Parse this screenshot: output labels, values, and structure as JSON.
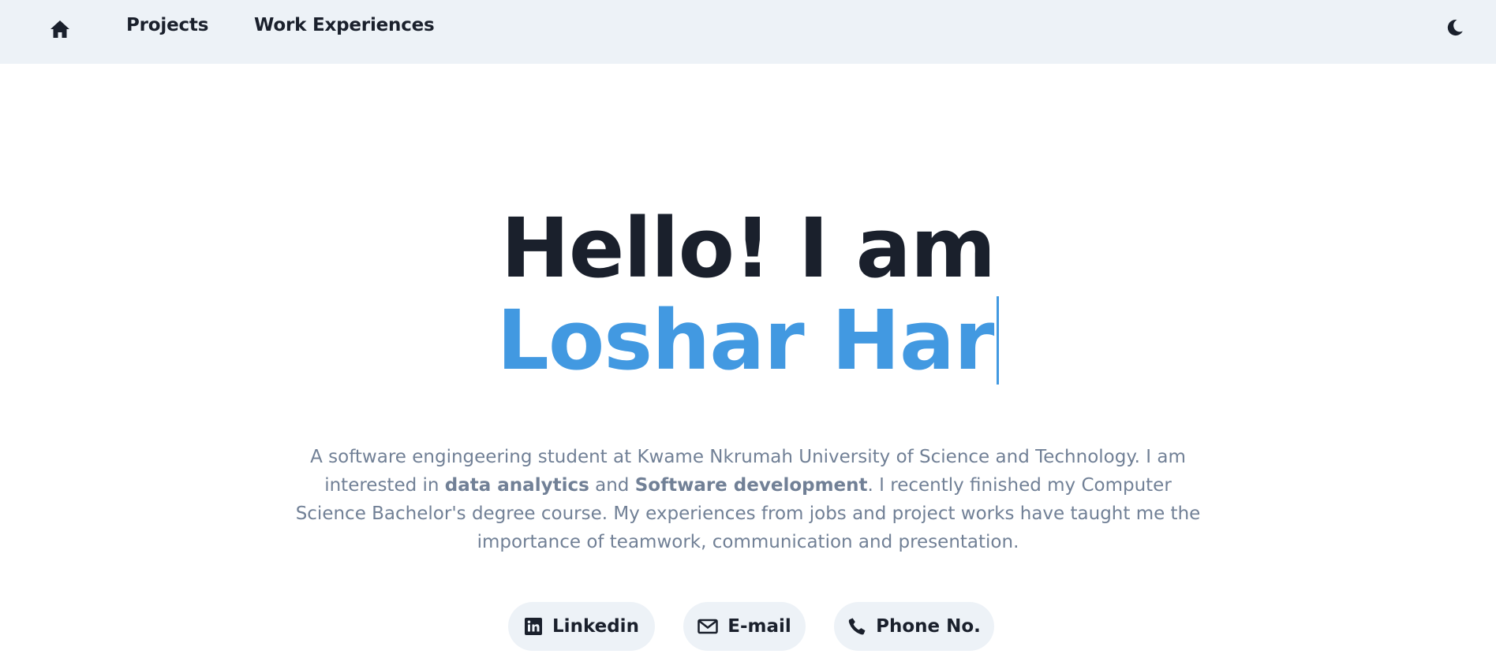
{
  "nav": {
    "home_icon": "home-icon",
    "projects_label": "Projects",
    "work_label": "Work Experiences",
    "theme_icon": "moon-icon"
  },
  "hero": {
    "greeting": "Hello! I am",
    "name_typed": "Loshar Har",
    "intro": {
      "part1": "A software engingeering student at Kwame Nkrumah University of Science and Technology. I am interested in ",
      "bold1": "data analytics",
      "part2": " and ",
      "bold2": "Software development",
      "part3": ". I recently finished my Computer Science Bachelor's degree course. My experiences from jobs and project works have taught me the importance of teamwork, communication and presentation."
    }
  },
  "contacts": {
    "linkedin_label": "Linkedin",
    "linkedin_icon": "linkedin-icon",
    "email_label": "E-mail",
    "email_icon": "envelope-icon",
    "phone_label": "Phone No.",
    "phone_icon": "phone-icon"
  },
  "colors": {
    "accent": "#4299e1",
    "nav_bg": "#edf2f7",
    "text": "#1a202c",
    "muted": "#718096"
  }
}
